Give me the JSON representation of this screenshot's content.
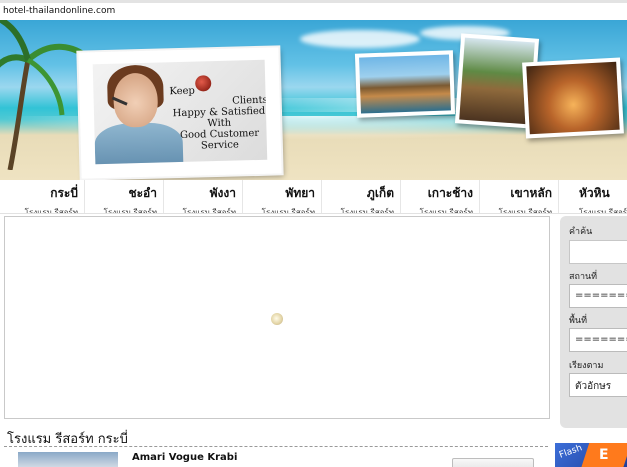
{
  "site": {
    "domain": "hotel-thailandonline.com"
  },
  "banner": {
    "slogan": [
      "Keep",
      "Clients",
      "Happy & Satisfied",
      "With",
      "Good Customer Service"
    ]
  },
  "nav": {
    "items": [
      {
        "title": "กระบี่",
        "sub": "โรงแรม รีสอร์ท"
      },
      {
        "title": "ชะอำ",
        "sub": "โรงแรม รีสอร์ท"
      },
      {
        "title": "พังงา",
        "sub": "โรงแรม รีสอร์ท"
      },
      {
        "title": "พัทยา",
        "sub": "โรงแรม รีสอร์ท"
      },
      {
        "title": "ภูเก็ต",
        "sub": "โรงแรม รีสอร์ท"
      },
      {
        "title": "เกาะช้าง",
        "sub": "โรงแรม รีสอร์ท"
      },
      {
        "title": "เขาหลัก",
        "sub": "โรงแรม รีสอร์ท"
      },
      {
        "title": "หัวหิน",
        "sub": "โรงแรม รีสอร์ท"
      }
    ]
  },
  "search": {
    "keyword_label": "คำค้น",
    "keyword_value": "",
    "place_label": "สถานที่",
    "place_value": "=========",
    "area_label": "พื้นที่",
    "area_value": "=========",
    "sort_label": "เรียงตาม",
    "sort_value": "ตัวอักษร"
  },
  "section": {
    "title": "โรงแรม รีสอร์ท กระบี่"
  },
  "hotels": [
    {
      "name": "Amari Vogue Krabi"
    }
  ],
  "ad": {
    "text": "Flash",
    "letter": "E"
  },
  "colors": {
    "panel": "#e2e2e2",
    "nav_border": "#e6e6e6",
    "ad_blue": "#2d55c0",
    "ad_orange": "#ff7a1c"
  }
}
